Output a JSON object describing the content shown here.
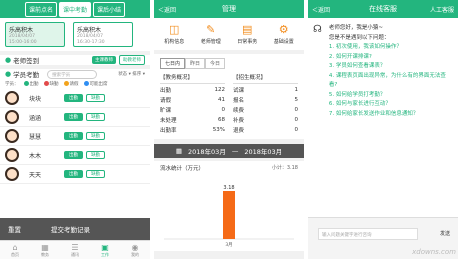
{
  "screen1": {
    "tabs": [
      "课前点名",
      "课中考勤",
      "课后小结"
    ],
    "active_tab": 1,
    "classes": [
      {
        "name": "乐高积木",
        "sub1": "2018/04/07",
        "sub2": "15:00-16:00"
      },
      {
        "name": "乐高积木",
        "sub1": "2018/04/07",
        "sub2": "16:30-17:30"
      }
    ],
    "teacher_section": "老师签到",
    "teacher_btn": "主课教师",
    "teacher_btn2": "助教老师",
    "student_section": "学员考勤",
    "search_placeholder": "搜索学员",
    "filter_label": "状态 ▾ 排序 ▾",
    "legend_label": "学员：",
    "legend": [
      {
        "label": "出勤",
        "color": "#23b57e"
      },
      {
        "label": "缺勤",
        "color": "#e24a4a"
      },
      {
        "label": "请假",
        "color": "#f2a31c"
      },
      {
        "label": "可能出席",
        "color": "#2f8ef2"
      }
    ],
    "students": [
      {
        "name": "块块",
        "b1": "出勤",
        "b2": "缺勤"
      },
      {
        "name": "涵涵",
        "b1": "出勤",
        "b2": "缺勤"
      },
      {
        "name": "慧慧",
        "b1": "出勤",
        "b2": "缺勤"
      },
      {
        "name": "木木",
        "b1": "出勤",
        "b2": "缺勤"
      },
      {
        "name": "天天",
        "b1": "出勤",
        "b2": "缺勤"
      }
    ],
    "overlay_left": "重置",
    "overlay_right": "提交考勤记录",
    "nav": [
      "首页",
      "教务",
      "通讯",
      "工作",
      "我的"
    ]
  },
  "screen2": {
    "back": "＜返回",
    "title": "管理",
    "menu": [
      {
        "label": "机构信息",
        "icon": "institution-icon"
      },
      {
        "label": "老师管理",
        "icon": "teacher-icon"
      },
      {
        "label": "日常事务",
        "icon": "calendar-icon"
      },
      {
        "label": "基础设置",
        "icon": "settings-icon"
      }
    ],
    "date_tabs": [
      "七日内",
      "昨日",
      "今日"
    ],
    "left_title": "【教务概况】",
    "right_title": "【招生概况】",
    "left_rows": [
      {
        "k": "出勤",
        "v": "122"
      },
      {
        "k": "请假",
        "v": "41"
      },
      {
        "k": "旷课",
        "v": "0"
      },
      {
        "k": "未处理",
        "v": "68"
      },
      {
        "k": "出勤率",
        "v": "53%"
      }
    ],
    "right_rows": [
      {
        "k": "试课",
        "v": "1"
      },
      {
        "k": "报名",
        "v": "5"
      },
      {
        "k": "续费",
        "v": "0"
      },
      {
        "k": "补费",
        "v": "0"
      },
      {
        "k": "退费",
        "v": "0"
      }
    ],
    "date_from": "2018年03月",
    "date_to": "2018年03月",
    "chart_title": "流水统计（万元）",
    "chart_subtitle": "小计：3.18"
  },
  "chart_data": {
    "type": "bar",
    "categories": [
      "3月"
    ],
    "values": [
      3.18
    ],
    "title": "流水统计（万元）",
    "xlabel": "",
    "ylabel": ""
  },
  "screen3": {
    "back": "＜返回",
    "title": "在线客服",
    "right": "人工客服",
    "greeting": "老师您好，我是小猿~",
    "intro": "您是不是遇到以下问题：",
    "questions": [
      "1. 初次使用，我该如何操作？",
      "2. 如何开课排课?",
      "3. 学员如何查看课表？",
      "4. 课程表页面出现异常，为什么有的界面无法查看?",
      "5. 如何给学员打考勤？",
      "6. 如何与家长进行互动？",
      "7. 如何给家长发送作业和信息通知？"
    ],
    "input_placeholder": "输入问题关键字进行咨询",
    "send": "发送",
    "watermark": "xdowns.com"
  }
}
